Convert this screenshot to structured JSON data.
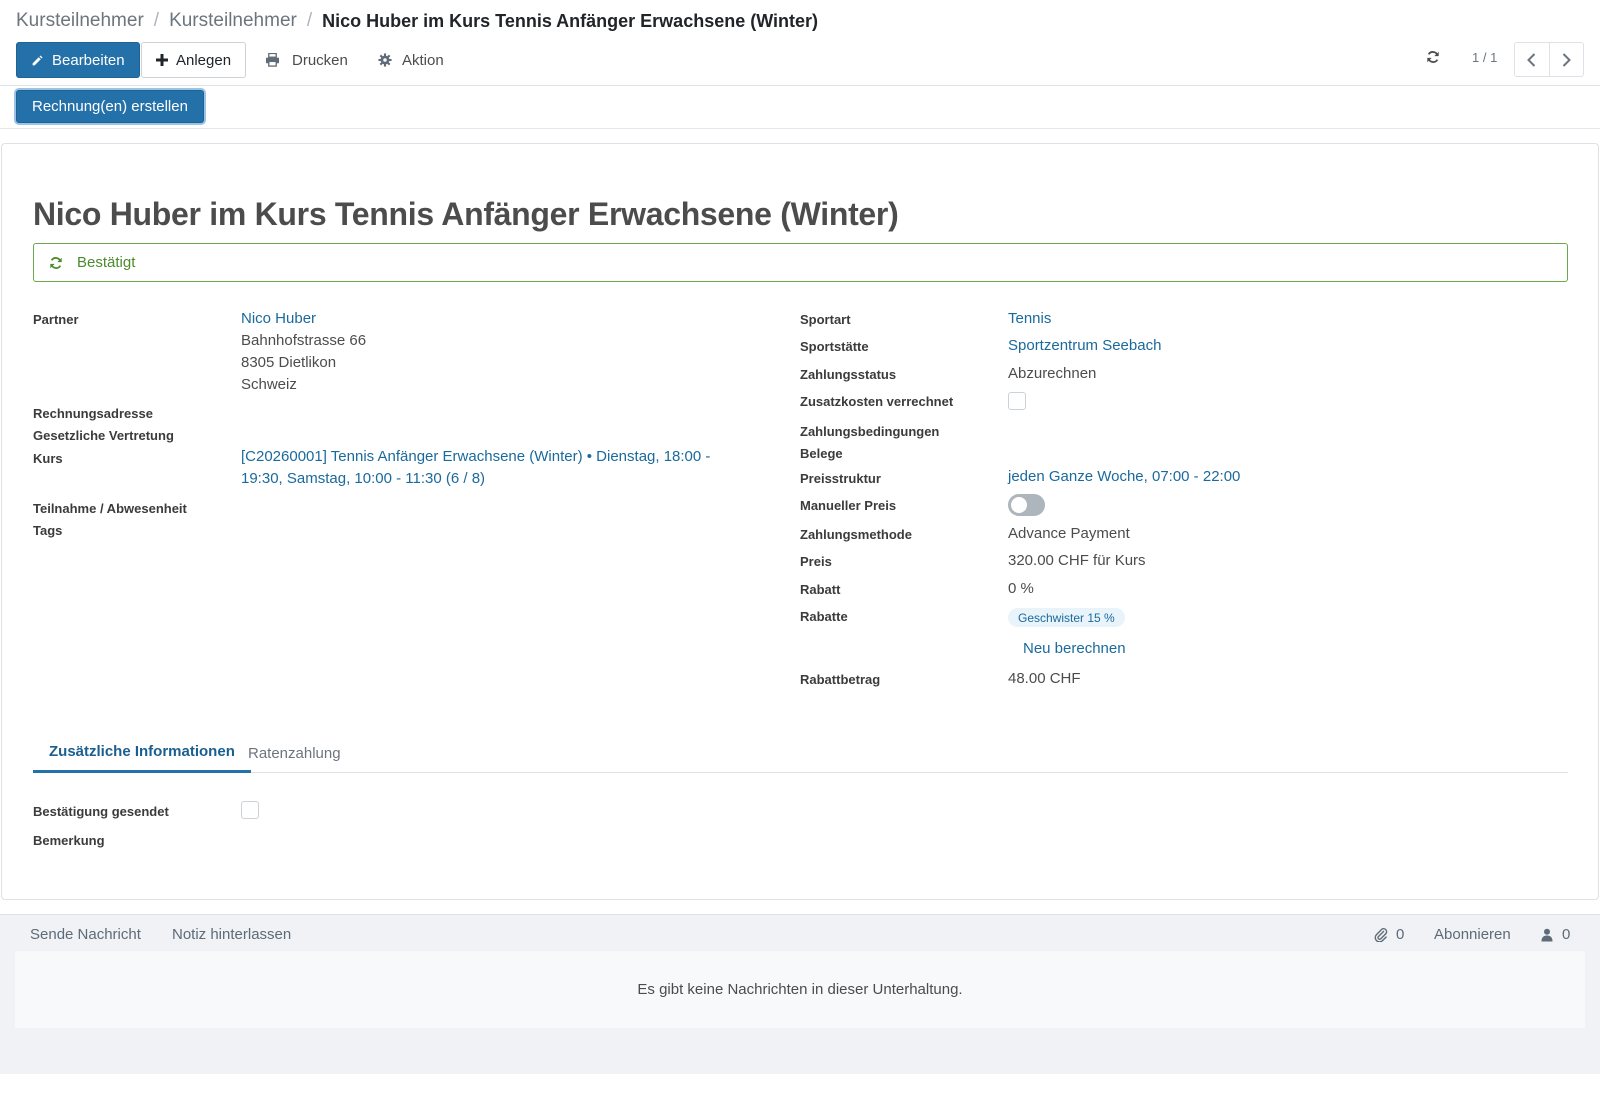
{
  "breadcrumb": {
    "items": [
      "Kursteilnehmer",
      "Kursteilnehmer"
    ],
    "separator": "/",
    "current": "Nico Huber im Kurs Tennis Anfänger Erwachsene (Winter)"
  },
  "toolbar": {
    "edit_label": "Bearbeiten",
    "create_label": "Anlegen",
    "print_label": "Drucken",
    "action_label": "Aktion"
  },
  "pager": {
    "value": "1 / 1"
  },
  "statusbar": {
    "invoice_button": "Rechnung(en) erstellen"
  },
  "record": {
    "title": "Nico Huber im Kurs Tennis Anfänger Erwachsene (Winter)",
    "state": "Bestätigt"
  },
  "left_fields": {
    "partner_label": "Partner",
    "partner_name": "Nico Huber",
    "partner_street": "Bahnhofstrasse 66",
    "partner_city": "8305 Dietlikon",
    "partner_country": "Schweiz",
    "invoice_address_label": "Rechnungsadresse",
    "legal_rep_label": "Gesetzliche Vertretung",
    "course_label": "Kurs",
    "course_line1": "[C20260001] Tennis Anfänger Erwachsene (Winter) • Dienstag, 18:00 -",
    "course_line2": "19:30, Samstag, 10:00 - 11:30 (6 / 8)",
    "attendance_label": "Teilnahme / Abwesenheit",
    "tags_label": "Tags"
  },
  "right_fields": {
    "sport_label": "Sportart",
    "sport_value": "Tennis",
    "venue_label": "Sportstätte",
    "venue_value": "Sportzentrum Seebach",
    "payment_status_label": "Zahlungsstatus",
    "payment_status_value": "Abzurechnen",
    "extra_costs_label": "Zusatzkosten verrechnet",
    "payment_terms_label": "Zahlungsbedingungen",
    "receipts_label": "Belege",
    "price_structure_label": "Preisstruktur",
    "price_structure_value": "jeden Ganze Woche, 07:00 - 22:00",
    "manual_price_label": "Manueller Preis",
    "payment_method_label": "Zahlungsmethode",
    "payment_method_value": "Advance Payment",
    "price_label": "Preis",
    "price_value": "320.00 CHF für Kurs",
    "discount_label": "Rabatt",
    "discount_value": "0  %",
    "discounts_label": "Rabatte",
    "discount_tag": "Geschwister 15 %",
    "recalc_label": "Neu berechnen",
    "discount_amount_label": "Rabattbetrag",
    "discount_amount_value": "48.00 CHF"
  },
  "tabs": {
    "tab1": "Zusätzliche Informationen",
    "tab2": "Ratenzahlung"
  },
  "tab_content": {
    "confirmation_label": "Bestätigung gesendet",
    "remark_label": "Bemerkung"
  },
  "chatter": {
    "send_message": "Sende Nachricht",
    "log_note": "Notiz hinterlassen",
    "attachments_count": "0",
    "follow_label": "Abonnieren",
    "followers_count": "0",
    "empty_message": "Es gibt keine Nachrichten in dieser Unterhaltung."
  },
  "colors": {
    "primary": "#2470a8",
    "link": "#1a6a9c",
    "state_green": "#4d8a2c"
  }
}
